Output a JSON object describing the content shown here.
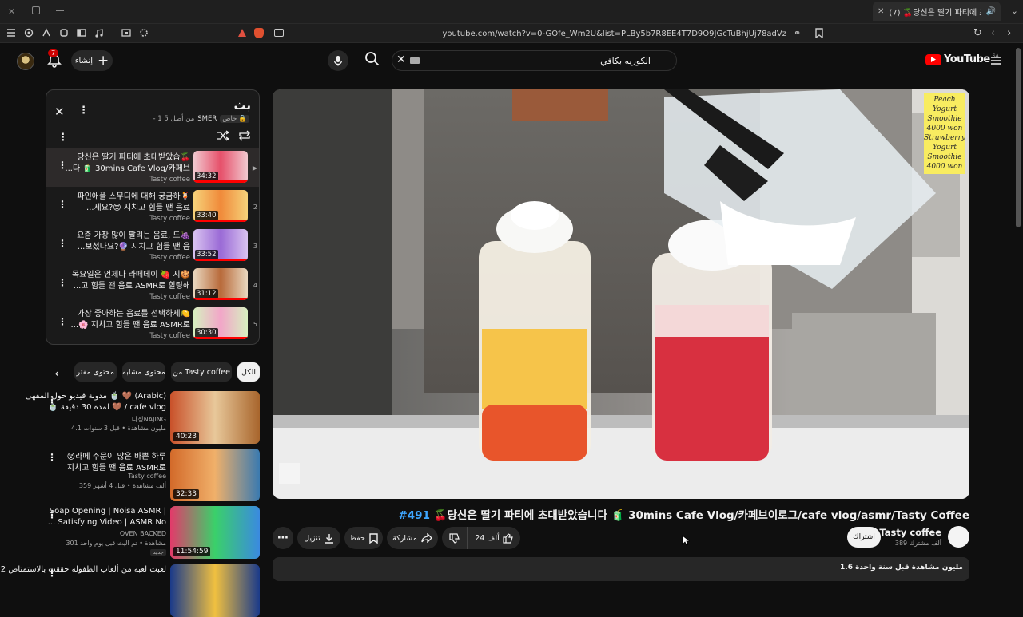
{
  "browser": {
    "tab_title": "(7) 🍒당신은 딸기 파티에 초",
    "url": "youtube.com/watch?v=0-GOfe_Wm2U&list=PLBy5b7R8EE4T7D9O9JGcTuBhjUj78adVz"
  },
  "header": {
    "logo": "YouTube",
    "region": "SA",
    "search_value": "الكوريه بكافي",
    "create_label": "إنشاء",
    "notif_count": "7"
  },
  "playlist": {
    "title": "بث",
    "privacy": "خاص",
    "owner": "SMER",
    "progress": "- 1 من أصل 5",
    "items": [
      {
        "line1": "당신은 딸기 파티에 초대받았습🍒",
        "line2": "...다 🧃 30mins Cafe Vlog/카페브",
        "channel": "Tasty coffee",
        "duration": "34:32",
        "index": "▶"
      },
      {
        "line1": "파인애플 스무디에 대해 궁금하🍹",
        "line2": "...세요?😊 지치고 힘들 땐 음료",
        "channel": "Tasty coffee",
        "duration": "33:40",
        "index": "2"
      },
      {
        "line1": "요즘 가장 많이 팔리는 음료, 드🍇",
        "line2": "...보셨나요?🔮 지치고 힘들 땐 음",
        "channel": "Tasty coffee",
        "duration": "33:52",
        "index": "3"
      },
      {
        "line1": "목요일은 언제나 라떼데이 🍓 지🍪",
        "line2": "...고 힘들 땐 음료 ASMR로 힐링해",
        "channel": "Tasty coffee",
        "duration": "31:12",
        "index": "4"
      },
      {
        "line1": "가장 좋아하는 음료를 선택하세🍋",
        "line2": "...🌸 지치고 힘들 땐 음료 ASMR로",
        "channel": "Tasty coffee",
        "duration": "30:30",
        "index": "5"
      }
    ]
  },
  "chips": [
    "الكل",
    "من Tasty coffee",
    "محتوى مشابه",
    "محتوى مقتر"
  ],
  "recommendations": [
    {
      "line1": "مدونة فيديو حول المقهى 🍵 🤎 (Arabic)",
      "line2": "🍵 لمدة 30 دقيقة 🤎 / cafe vlog",
      "channel": "나징NAJING",
      "meta": "4.1 مليون مشاهدة • قبل 3 سنوات",
      "duration": "40:23"
    },
    {
      "line1": "😵라떼 주문이 많은 바쁜 하루",
      "line2": "지치고 힘들 땐 음료 ASMR로",
      "channel": "Tasty coffee",
      "meta": "359 ألف مشاهدة • قبل 4 أشهر",
      "duration": "32:33"
    },
    {
      "line1": "Soap Opening | Noisa ASMR |",
      "line2": "... Satisfying Video | ASMR No",
      "channel": "OVEN BACKED",
      "meta": "301 مشاهدة • تم البث قبل يوم واحد",
      "duration": "11:54:59",
      "badge": "جديد"
    },
    {
      "line1": "لعبت لعبة من ألعاب الطفولة حققت بالاستمتاص 2",
      "line2": "",
      "channel": "",
      "meta": "",
      "duration": ""
    }
  ],
  "video": {
    "title": "#491 🍒당신은 딸기 파티에 초대받았습니다 🧃 30mins Cafe Vlog/카페브이로그/cafe vlog/asmr/Tasty Coffee",
    "title_tag": "#491",
    "menu_board": [
      "Peach",
      "Yogurt",
      "Smoothie",
      "4000 won",
      "Strawberry",
      "Yogurt",
      "Smoothie",
      "4000 won"
    ],
    "channel": "Tasty coffee",
    "subscribers": "389 ألف مشترك",
    "subscribe": "اشتراك",
    "likes": "24 ألف",
    "share": "مشاركة",
    "save": "حفظ",
    "download": "تنزيل",
    "views_line": "1.6 مليون مشاهدة قبل سنة واحدة"
  }
}
